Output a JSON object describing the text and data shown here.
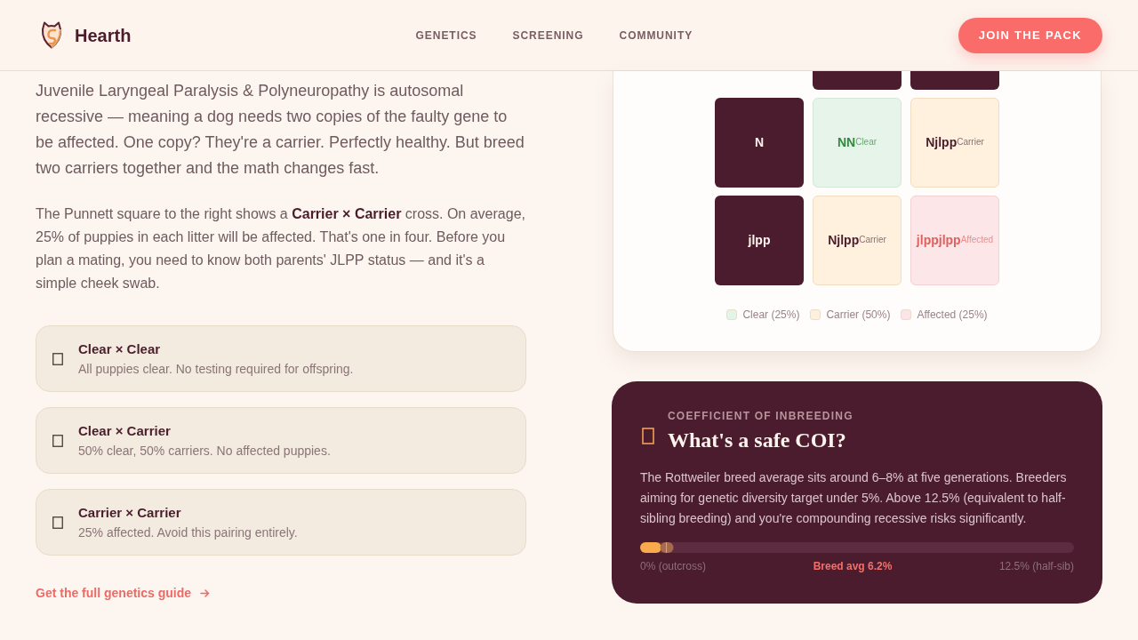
{
  "header": {
    "brand": "Hearth",
    "nav": [
      {
        "label": "GENETICS"
      },
      {
        "label": "SCREENING"
      },
      {
        "label": "COMMUNITY"
      }
    ],
    "cta": "JOIN THE PACK"
  },
  "intro": {
    "paragraphs": [
      {
        "kind": "lead",
        "text": "Juvenile Laryngeal Paralysis & Polyneuropathy is autosomal recessive — meaning a dog needs two copies of the faulty gene to be affected. One copy? They're a carrier. Perfectly healthy. But breed two carriers together and the math changes fast."
      },
      {
        "kind": "body",
        "text": "The Punnett square to the right shows a **Carrier × Carrier** cross. On average, 25% of puppies in each litter will be affected. That's one in four. Before you plan a mating, you need to know both parents' JLPP status — and it's a simple cheek swab."
      }
    ]
  },
  "pairings": [
    {
      "title": "Clear × Clear",
      "description": "All puppies clear. No testing required for offspring."
    },
    {
      "title": "Clear × Carrier",
      "description": "50% clear, 50% carriers. No affected puppies."
    },
    {
      "title": "Carrier × Carrier",
      "description": "25% affected. Avoid this pairing entirely."
    }
  ],
  "guide_link": "Get the full genetics guide",
  "punnett": {
    "rows": [
      {
        "allele": "N",
        "cells": [
          {
            "kind": "clear",
            "genotype": "NN",
            "status": "Clear"
          },
          {
            "kind": "carrier",
            "genotype": "Njlpp",
            "status": "Carrier"
          }
        ]
      },
      {
        "allele": "jlpp",
        "cells": [
          {
            "kind": "carrier",
            "genotype": "Njlpp",
            "status": "Carrier"
          },
          {
            "kind": "affected",
            "genotype": "jlppjlpp",
            "status": "Affected"
          }
        ]
      }
    ],
    "legend": [
      {
        "label": "Clear (25%)",
        "color": "#e2f5e7"
      },
      {
        "label": "Carrier (50%)",
        "color": "#fdf1dd"
      },
      {
        "label": "Affected (25%)",
        "color": "#fde4e7"
      }
    ]
  },
  "coi": {
    "eyebrow": "COEFFICIENT OF INBREEDING",
    "title": "What's a safe COI?",
    "body": "The Rottweiler breed average sits around 6–8% at five generations. Breeders aiming for genetic diversity target under 5%. Above 12.5% (equivalent to half-sibling breeding) and you're compounding recessive risks significantly.",
    "meter": {
      "level": 0.05,
      "marker": {
        "level": 0.062
      }
    },
    "scale_labels": [
      {
        "kind": "end",
        "text": "0% (outcross)"
      },
      {
        "kind": "highlight",
        "text": "Breed avg 6.2%"
      },
      {
        "kind": "end",
        "text": "12.5% (half-sib)"
      }
    ]
  }
}
